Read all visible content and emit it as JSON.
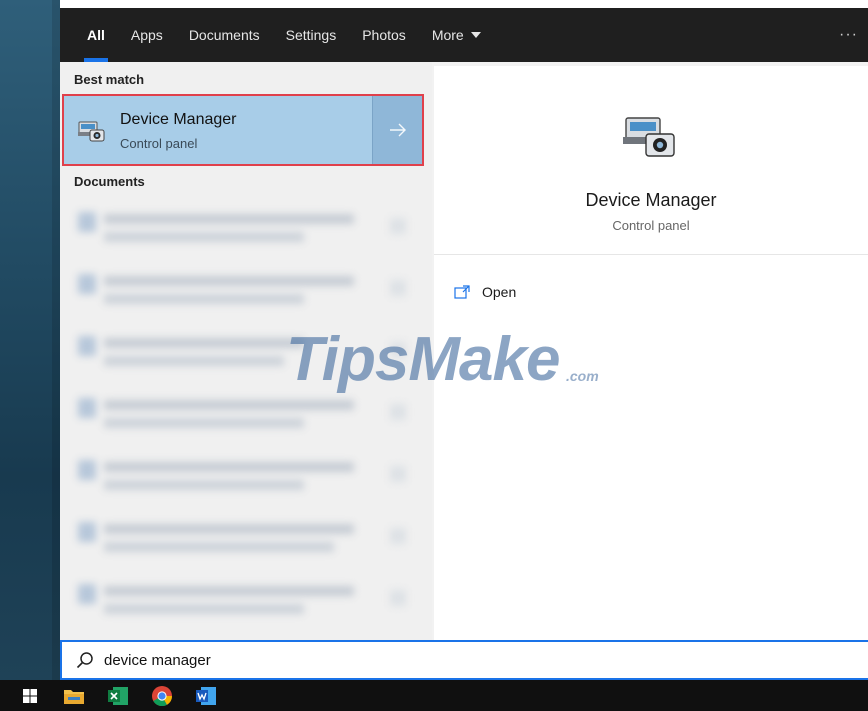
{
  "tabs": [
    {
      "label": "All",
      "active": true
    },
    {
      "label": "Apps"
    },
    {
      "label": "Documents"
    },
    {
      "label": "Settings"
    },
    {
      "label": "Photos"
    },
    {
      "label": "More"
    }
  ],
  "tab_more_icon": "ellipsis-icon",
  "tab_more_glyph": "···",
  "results": {
    "best_match_label": "Best match",
    "best_match": {
      "title": "Device Manager",
      "subtitle": "Control panel",
      "icon": "device-manager-icon",
      "arrow_icon": "arrow-right-icon"
    },
    "documents_label": "Documents"
  },
  "preview": {
    "title": "Device Manager",
    "subtitle": "Control panel",
    "open_label": "Open",
    "open_icon": "open-window-icon"
  },
  "watermark": {
    "main": "TipsMake",
    "suffix": ".com"
  },
  "search": {
    "value": "device manager",
    "icon": "search-icon"
  },
  "taskbar": {
    "items": [
      "windows-start-icon",
      "file-explorer-icon",
      "excel-icon",
      "chrome-icon",
      "word-icon"
    ]
  },
  "colors": {
    "accent": "#1a73e8",
    "highlight": "#a8cde8",
    "selection_border": "#e0404b"
  }
}
